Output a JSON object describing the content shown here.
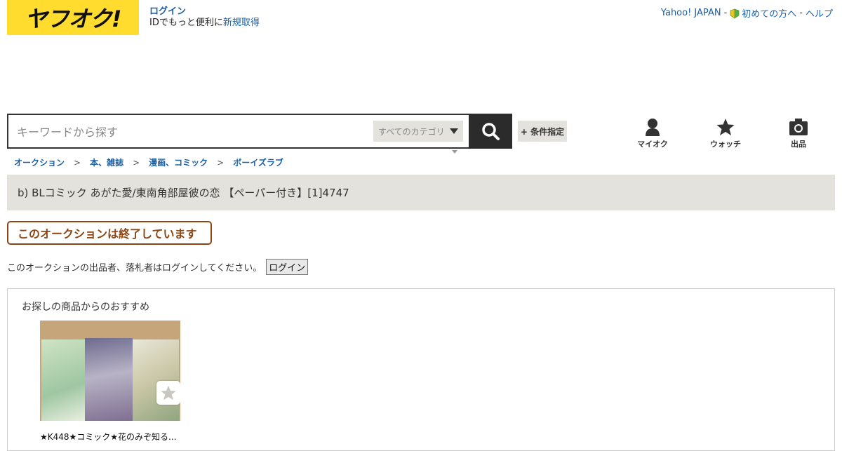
{
  "header": {
    "logo_text": "ヤフオク!",
    "login_label": "ログイン",
    "id_text": "IDでもっと便利に",
    "signup_label": "新規取得",
    "yahoo_japan": "Yahoo! JAPAN",
    "beginner_label": "初めての方へ",
    "help_label": "ヘルプ",
    "separator": "-"
  },
  "search": {
    "placeholder": "キーワードから探す",
    "category_value": "すべてのカテゴリ",
    "advanced_label": "+ 条件指定"
  },
  "nav": {
    "myauction_label": "マイオク",
    "watch_label": "ウォッチ",
    "sell_label": "出品"
  },
  "breadcrumb": {
    "separator": ">",
    "items": [
      "オークション",
      "本、雑誌",
      "漫画、コミック",
      "ボーイズラブ"
    ]
  },
  "item": {
    "title": "b) BLコミック あがた愛/東南角部屋彼の恋 【ペーパー付き】[1]4747"
  },
  "status": {
    "ended_text": "このオークションは終了しています",
    "login_note": "このオークションの出品者、落札者はログインしてください。",
    "login_button": "ログイン"
  },
  "recommend": {
    "title": "お探しの商品からのおすすめ",
    "items": [
      {
        "name": "★K448★コミック★花のみぞ知る..."
      }
    ]
  },
  "colors": {
    "brand_yellow": "#ffdc2e",
    "link_blue": "#1b5fa6",
    "ended_brown": "#8b4513",
    "panel_gray": "#e3e2dc",
    "search_dark": "#2b2b2b"
  },
  "icons": [
    "beginner-leaf-icon",
    "search-icon",
    "dropdown-icon",
    "person-icon",
    "star-icon",
    "camera-icon"
  ]
}
